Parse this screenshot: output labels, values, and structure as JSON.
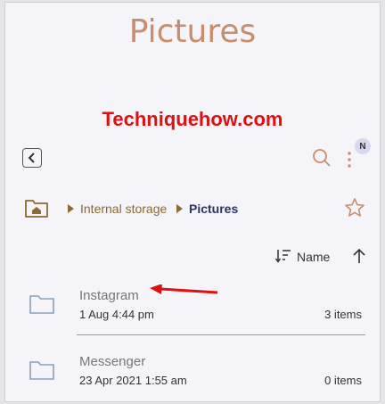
{
  "header": {
    "title": "Pictures"
  },
  "watermark": "Techniquehow.com",
  "toolbar": {
    "back_icon": "chevron-left-icon",
    "search_icon": "search-icon",
    "more_icon": "more-vertical-icon",
    "avatar_initial": "N"
  },
  "breadcrumb": {
    "home_icon": "home-folder-icon",
    "items": [
      {
        "label": "Internal storage"
      },
      {
        "label": "Pictures"
      }
    ],
    "favorite_icon": "star-icon"
  },
  "sort": {
    "label": "Name",
    "sort_icon": "sort-lines-icon",
    "direction_icon": "arrow-up-icon"
  },
  "folders": [
    {
      "name": "Instagram",
      "date": "1 Aug 4:44 pm",
      "count": "3 items"
    },
    {
      "name": "Messenger",
      "date": "23 Apr 2021 1:55 am",
      "count": "0 items"
    }
  ],
  "colors": {
    "title": "#c98d6e",
    "watermark": "#e01010",
    "breadcrumb": "#8a6b32",
    "breadcrumb_current": "#2c3566",
    "annotation_arrow": "#e01010"
  }
}
